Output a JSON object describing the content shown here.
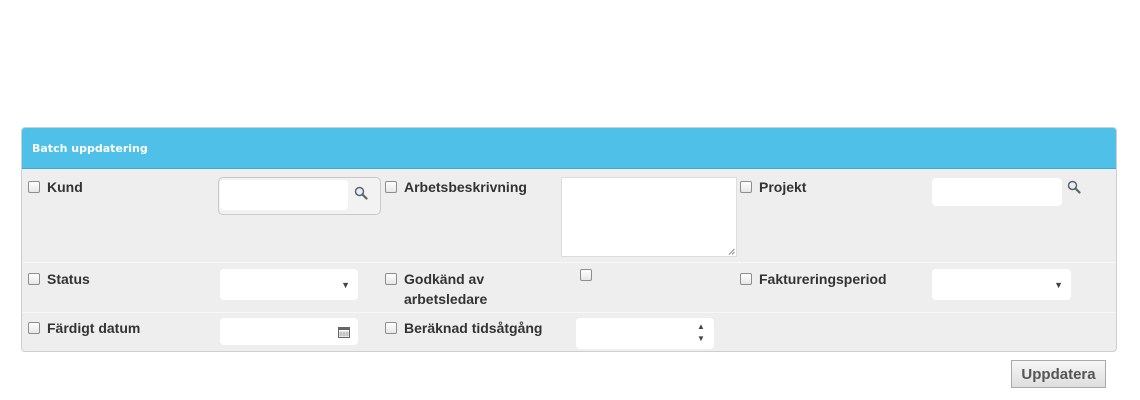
{
  "panel": {
    "title": "Batch uppdatering"
  },
  "fields": {
    "kund": {
      "label": "Kund",
      "value": "",
      "placeholder": ""
    },
    "arbetsbeskrivning": {
      "label": "Arbetsbeskrivning",
      "value": ""
    },
    "projekt": {
      "label": "Projekt",
      "value": "",
      "placeholder": ""
    },
    "status": {
      "label": "Status",
      "selected": ""
    },
    "godkand": {
      "label_line1": "Godkänd av",
      "label_line2": "arbetsledare",
      "checked": false
    },
    "faktureringsperiod": {
      "label": "Faktureringsperiod",
      "selected": ""
    },
    "fardigt_datum": {
      "label": "Färdigt datum",
      "value": ""
    },
    "berakn_tid": {
      "label": "Beräknad tidsåtgång",
      "value": ""
    }
  },
  "actions": {
    "update_label": "Uppdatera"
  },
  "icons": {
    "search": "search-icon",
    "calendar": "calendar-icon",
    "dropdown": "chevron-down-icon",
    "spinner": "spinner-icon"
  },
  "colors": {
    "header_bg": "#4fc1e9",
    "panel_bg": "#eeeeee"
  }
}
